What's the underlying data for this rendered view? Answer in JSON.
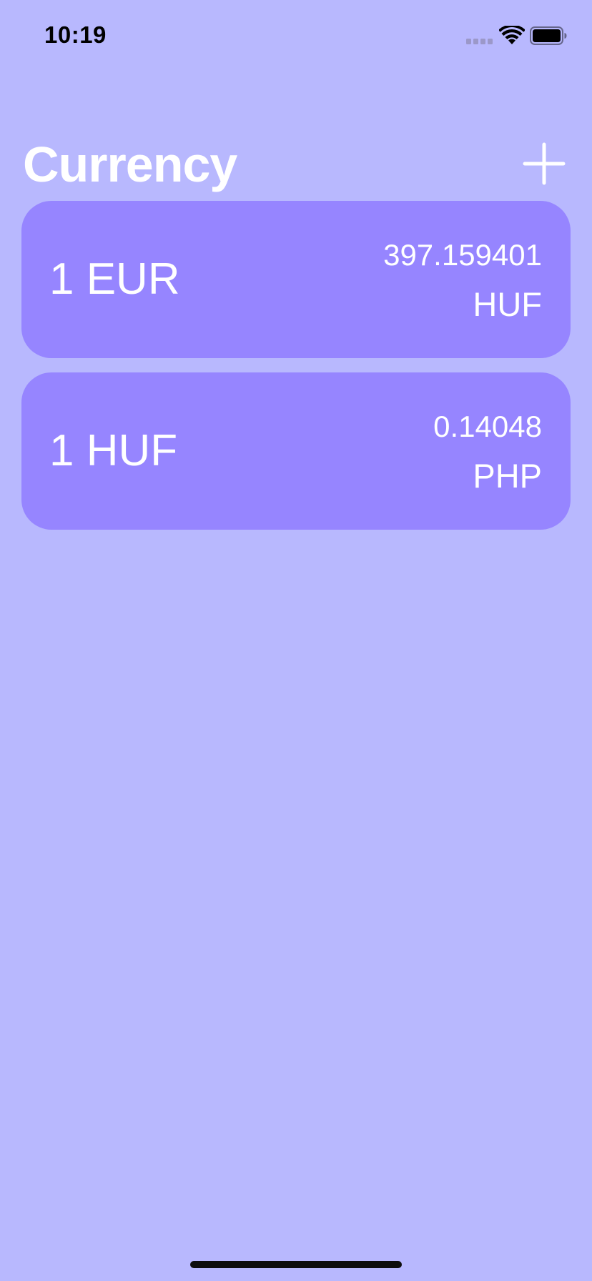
{
  "status_bar": {
    "time": "10:19",
    "signal_icon": "signal-dots-icon",
    "wifi_icon": "wifi-icon",
    "battery_icon": "battery-icon"
  },
  "header": {
    "title": "Currency",
    "add_icon": "plus-icon"
  },
  "cards": [
    {
      "from": "1 EUR",
      "rate": "397.159401",
      "to": "HUF"
    },
    {
      "from": "1 HUF",
      "rate": "0.14048",
      "to": "PHP"
    }
  ],
  "colors": {
    "background": "#b8b8fe",
    "card": "#9685ff",
    "text": "#ffffff"
  }
}
